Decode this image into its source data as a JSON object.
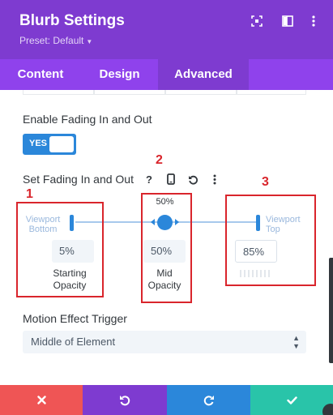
{
  "header": {
    "title": "Blurb Settings",
    "preset": "Preset: Default",
    "icons": [
      "fullscreen-icon",
      "sidebar-layout-icon",
      "more-vertical-icon"
    ]
  },
  "tabs": [
    {
      "label": "Content",
      "active": false
    },
    {
      "label": "Design",
      "active": false
    },
    {
      "label": "Advanced",
      "active": true
    }
  ],
  "fading": {
    "toggle_label": "Enable Fading In and Out",
    "toggle_value": "YES",
    "set_label": "Set Fading In and Out",
    "control_icons": [
      "help-icon",
      "mobile-icon",
      "reset-icon",
      "more-vertical-icon"
    ]
  },
  "slider": {
    "left_label": [
      "Viewport",
      "Bottom"
    ],
    "right_label": [
      "Viewport",
      "Top"
    ],
    "mid_value": "50%",
    "starting_opacity": {
      "value": "5%",
      "caption": [
        "Starting",
        "Opacity"
      ]
    },
    "mid_opacity": {
      "value": "50%",
      "caption": [
        "Mid",
        "Opacity"
      ]
    },
    "ending_opacity": {
      "value": "85%"
    }
  },
  "annotations": [
    "1",
    "2",
    "3"
  ],
  "trigger": {
    "label": "Motion Effect Trigger",
    "value": "Middle of Element"
  },
  "footer": {
    "buttons": [
      {
        "icon": "close-icon",
        "color": "#ef5555"
      },
      {
        "icon": "undo-icon",
        "color": "#7e3bd0"
      },
      {
        "icon": "redo-icon",
        "color": "#2b87da"
      },
      {
        "icon": "check-icon",
        "color": "#29c4a9"
      }
    ]
  },
  "colors": {
    "header": "#7e3bd0",
    "tabs": "#8f42ec",
    "accent": "#2b87da",
    "annotation": "#d9252c"
  }
}
